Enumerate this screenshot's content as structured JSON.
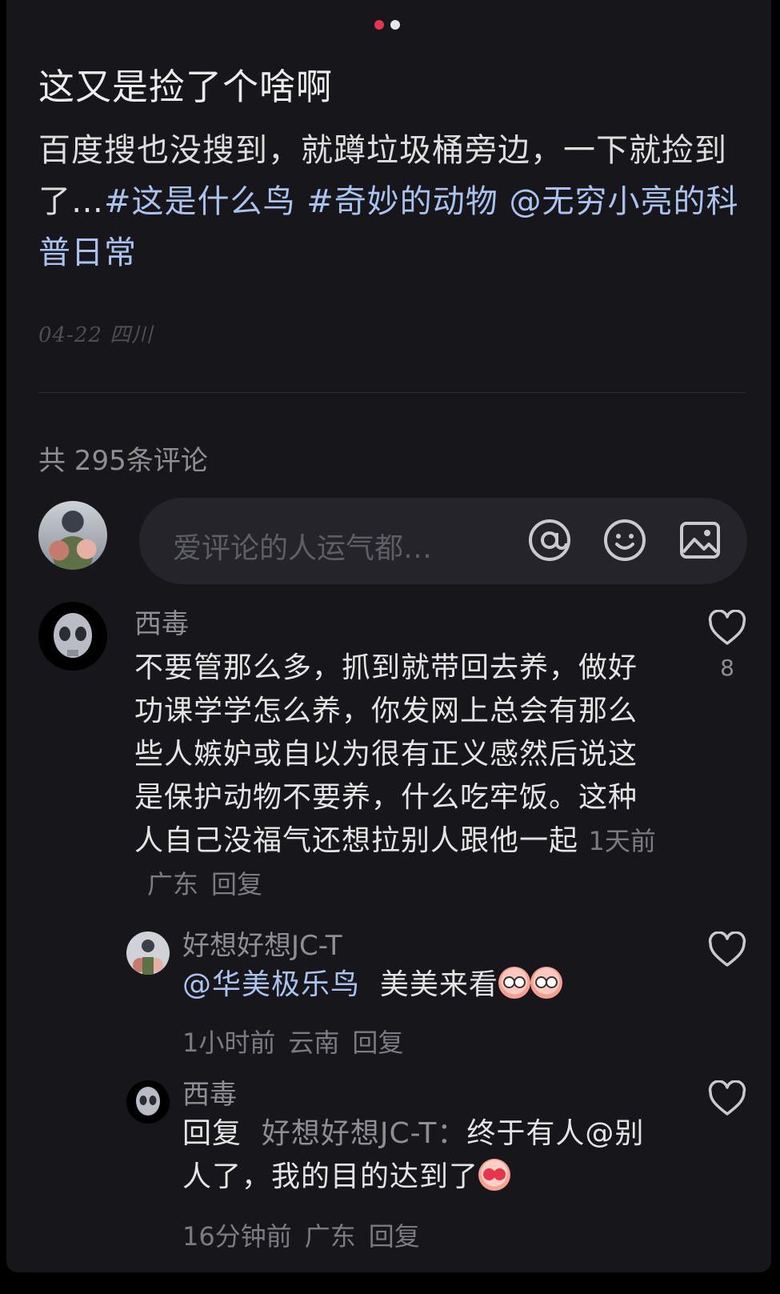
{
  "page_indicator": {
    "total": 2,
    "active_index": 0
  },
  "post": {
    "title": "这又是捡了个啥啊",
    "description": {
      "text": "百度搜也没搜到，就蹲垃圾桶旁边，一下就捡到了…",
      "tags": [
        "#这是什么鸟",
        "#奇妙的动物",
        "@无穷小亮的科普日常"
      ]
    },
    "meta": "04-22 四川"
  },
  "comments_count_label": "共 295条评论",
  "composer": {
    "placeholder": "爱评论的人运气都…",
    "icons": [
      "at-icon",
      "emoji-icon",
      "image-icon"
    ]
  },
  "comments": [
    {
      "username": "西毒",
      "text": "不要管那么多，抓到就带回去养，做好功课学学怎么养，你发网上总会有那么些人嫉妒或自以为很有正义感然后说这是保护动物不要养，什么吃牢饭。这种人自己没福气还想拉别人跟他一起",
      "time": "1天前",
      "location": "广东",
      "reply_label": "回复",
      "likes": "8",
      "replies": [
        {
          "username": "好想好想JC-T",
          "mention": "@华美极乐鸟",
          "text": "美美来看",
          "time": "1小时前",
          "location": "云南",
          "reply_label": "回复"
        },
        {
          "username": "西毒",
          "reply_prefix": "回复",
          "reply_target": "好想好想JC-T：",
          "text": "终于有人@别人了，我的目的达到了",
          "time": "16分钟前",
          "location": "广东",
          "reply_label": "回复"
        }
      ]
    }
  ],
  "colors": {
    "background": "#16161b",
    "accent": "#e8344e",
    "link": "#a9c2ee"
  }
}
